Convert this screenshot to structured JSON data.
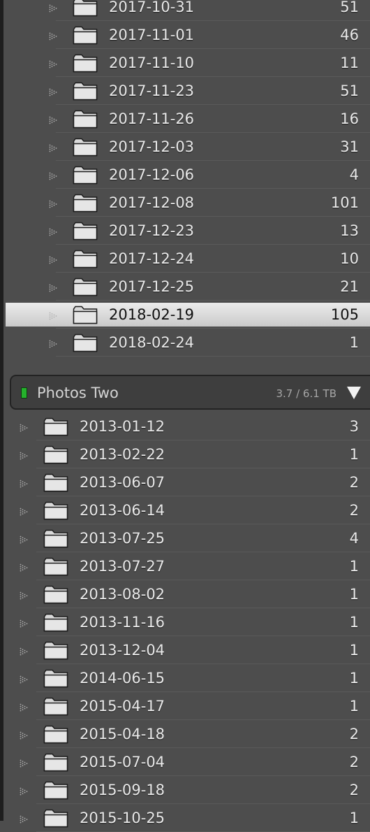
{
  "colors": {
    "panel_background": "#4d4d4d",
    "selected_row": "#dcdcdc",
    "volume_status": "#25b22c"
  },
  "folder_group_one": [
    {
      "name": "2017-10-31",
      "count": "51"
    },
    {
      "name": "2017-11-01",
      "count": "46"
    },
    {
      "name": "2017-11-10",
      "count": "11"
    },
    {
      "name": "2017-11-23",
      "count": "51"
    },
    {
      "name": "2017-11-26",
      "count": "16"
    },
    {
      "name": "2017-12-03",
      "count": "31"
    },
    {
      "name": "2017-12-06",
      "count": "4"
    },
    {
      "name": "2017-12-08",
      "count": "101"
    },
    {
      "name": "2017-12-23",
      "count": "13"
    },
    {
      "name": "2017-12-24",
      "count": "10"
    },
    {
      "name": "2017-12-25",
      "count": "21"
    },
    {
      "name": "2018-02-19",
      "count": "105",
      "selected": true
    },
    {
      "name": "2018-02-24",
      "count": "1"
    }
  ],
  "volume": {
    "name": "Photos Two",
    "usage": "3.7 / 6.1 TB",
    "status_icon": "green-status-icon",
    "collapse_icon": "triangle-down-icon"
  },
  "folder_group_two": [
    {
      "name": "2013-01-12",
      "count": "3"
    },
    {
      "name": "2013-02-22",
      "count": "1"
    },
    {
      "name": "2013-06-07",
      "count": "2"
    },
    {
      "name": "2013-06-14",
      "count": "2"
    },
    {
      "name": "2013-07-25",
      "count": "4"
    },
    {
      "name": "2013-07-27",
      "count": "1"
    },
    {
      "name": "2013-08-02",
      "count": "1"
    },
    {
      "name": "2013-11-16",
      "count": "1"
    },
    {
      "name": "2013-12-04",
      "count": "1"
    },
    {
      "name": "2014-06-15",
      "count": "1"
    },
    {
      "name": "2015-04-17",
      "count": "1"
    },
    {
      "name": "2015-04-18",
      "count": "2"
    },
    {
      "name": "2015-07-04",
      "count": "2"
    },
    {
      "name": "2015-09-18",
      "count": "2"
    },
    {
      "name": "2015-10-25",
      "count": "1"
    }
  ],
  "icons": {
    "row_expander": "disclosure-triangle-icon",
    "row_folder": "folder-icon"
  }
}
